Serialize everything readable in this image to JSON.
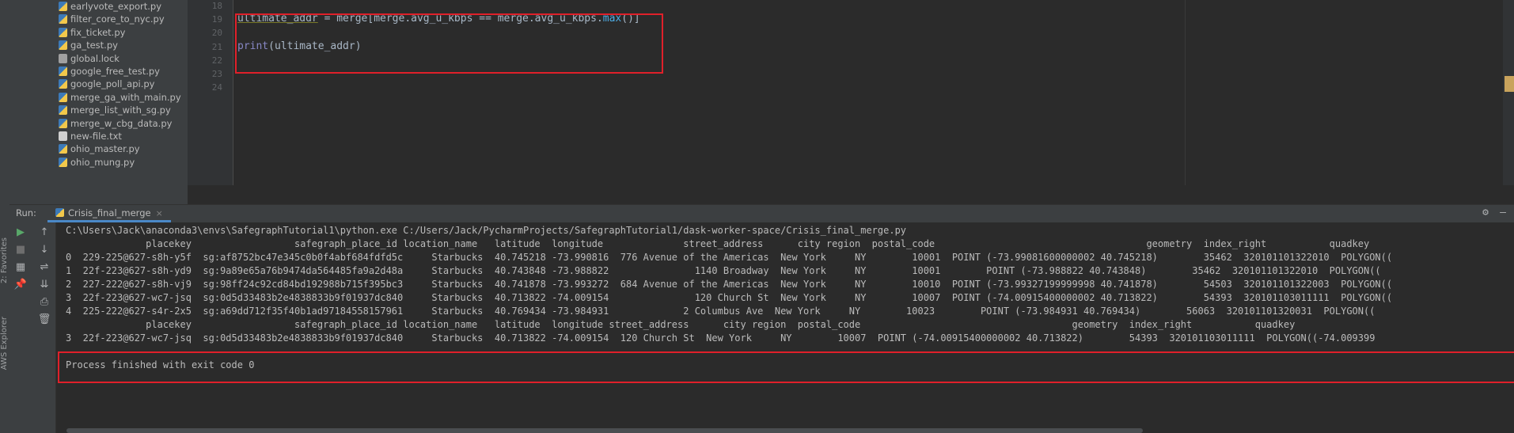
{
  "project_tree": {
    "files": [
      {
        "name": "earlyvote_export.py",
        "type": "py"
      },
      {
        "name": "filter_core_to_nyc.py",
        "type": "py"
      },
      {
        "name": "fix_ticket.py",
        "type": "py"
      },
      {
        "name": "ga_test.py",
        "type": "py"
      },
      {
        "name": "global.lock",
        "type": "lock"
      },
      {
        "name": "google_free_test.py",
        "type": "py"
      },
      {
        "name": "google_poll_api.py",
        "type": "py"
      },
      {
        "name": "merge_ga_with_main.py",
        "type": "py"
      },
      {
        "name": "merge_list_with_sg.py",
        "type": "py"
      },
      {
        "name": "merge_w_cbg_data.py",
        "type": "py"
      },
      {
        "name": "new-file.txt",
        "type": "txt"
      },
      {
        "name": "ohio_master.py",
        "type": "py"
      },
      {
        "name": "ohio_mung.py",
        "type": "py"
      }
    ]
  },
  "editor": {
    "line_numbers": [
      "18",
      "19",
      "20",
      "21",
      "22",
      "23",
      "24"
    ],
    "line19_var": "ultimate_addr",
    "line19_rest_a": " = merge[merge.avg_u_kbps == merge.avg_u_kbps.",
    "line19_max": "max",
    "line19_rest_b": "()]",
    "line21_print": "print",
    "line21_rest": "(ultimate_addr)"
  },
  "side_tabs": {
    "favorites": "2: Favorites",
    "aws": "AWS Explorer"
  },
  "run_panel": {
    "label": "Run:",
    "tab_name": "Crisis_final_merge",
    "close": "×"
  },
  "console": {
    "command": "C:\\Users\\Jack\\anaconda3\\envs\\SafegraphTutorial1\\python.exe C:/Users/Jack/PycharmProjects/SafegraphTutorial1/dask-worker-space/Crisis_final_merge.py",
    "header1": "              placekey                  safegraph_place_id location_name   latitude  longitude              street_address      city region  postal_code                                     geometry  index_right           quadkey      ",
    "rows": [
      "0  229-225@627-s8h-y5f  sg:af8752bc47e345c0b0f4abf684fdfd5c     Starbucks  40.745218 -73.990816  776 Avenue of the Americas  New York     NY        10001  POINT (-73.99081600000002 40.745218)        35462  320101101322010  POLYGON((",
      "1  22f-223@627-s8h-yd9  sg:9a89e65a76b9474da564485fa9a2d48a     Starbucks  40.743848 -73.988822               1140 Broadway  New York     NY        10001        POINT (-73.988822 40.743848)        35462  320101101322010  POLYGON((",
      "2  227-222@627-s8h-vj9  sg:98ff24c92cd84bd192988b715f395bc3     Starbucks  40.741878 -73.993272  684 Avenue of the Americas  New York     NY        10010  POINT (-73.99327199999998 40.741878)        54503  320101101322003  POLYGON((",
      "3  22f-223@627-wc7-jsq  sg:0d5d33483b2e4838833b9f01937dc840     Starbucks  40.713822 -74.009154               120 Church St  New York     NY        10007  POINT (-74.00915400000002 40.713822)        54393  320101103011111  POLYGON((",
      "4  225-222@627-s4r-2x5  sg:a69dd712f35f40b1ad97184558157961     Starbucks  40.769434 -73.984931             2 Columbus Ave  New York     NY        10023        POINT (-73.984931 40.769434)        56063  320101101320031  POLYGON(("
    ],
    "header2": "              placekey                  safegraph_place_id location_name   latitude  longitude street_address      city region  postal_code                                     geometry  index_right           quadkey",
    "result_row": "3  22f-223@627-wc7-jsq  sg:0d5d33483b2e4838833b9f01937dc840     Starbucks  40.713822 -74.009154  120 Church St  New York     NY        10007  POINT (-74.00915400000002 40.713822)        54393  320101103011111  POLYGON((-74.009399",
    "exit_message": "Process finished with exit code 0"
  }
}
